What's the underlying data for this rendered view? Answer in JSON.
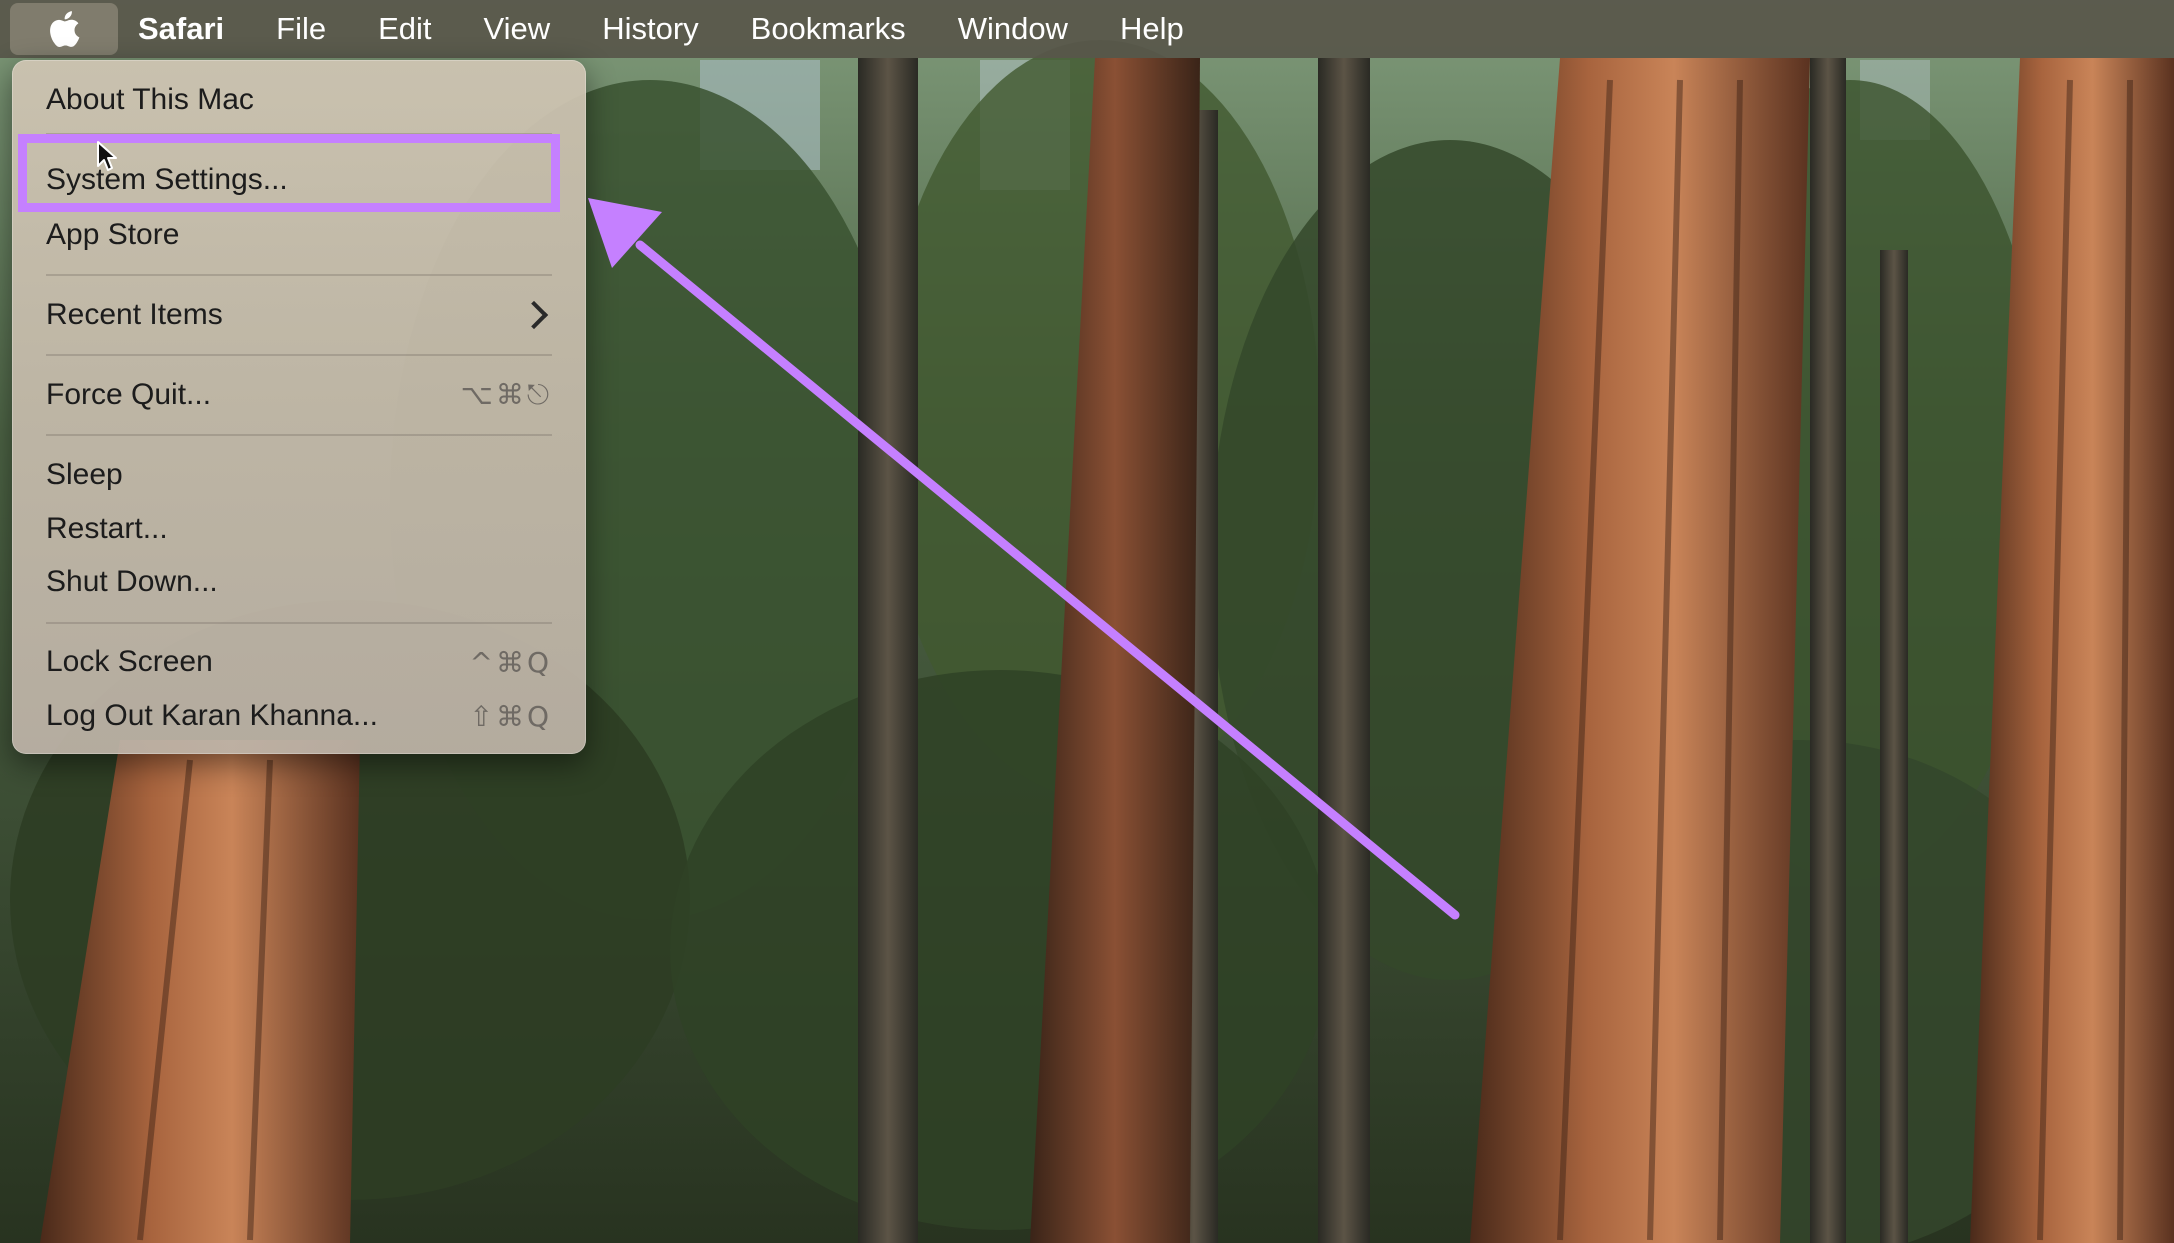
{
  "menubar": {
    "apple_icon": "apple-logo-icon",
    "app_name": "Safari",
    "items": [
      "File",
      "Edit",
      "View",
      "History",
      "Bookmarks",
      "Window",
      "Help"
    ]
  },
  "apple_menu": {
    "about": "About This Mac",
    "system_settings": "System Settings...",
    "app_store": "App Store",
    "recent_items": "Recent Items",
    "recent_items_icon": "chevron-right-icon",
    "force_quit": "Force Quit...",
    "force_quit_shortcut": "⌥⌘⎋",
    "sleep": "Sleep",
    "restart": "Restart...",
    "shut_down": "Shut Down...",
    "lock_screen": "Lock Screen",
    "lock_screen_shortcut": "^⌘Q",
    "log_out": "Log Out Karan Khanna...",
    "log_out_shortcut": "⇧⌘Q"
  },
  "annotation": {
    "highlight_color": "#c580ff",
    "arrow_color": "#c580ff"
  },
  "colors": {
    "menubar_bg": "#58564a",
    "menu_bg": "#cec4b2"
  }
}
